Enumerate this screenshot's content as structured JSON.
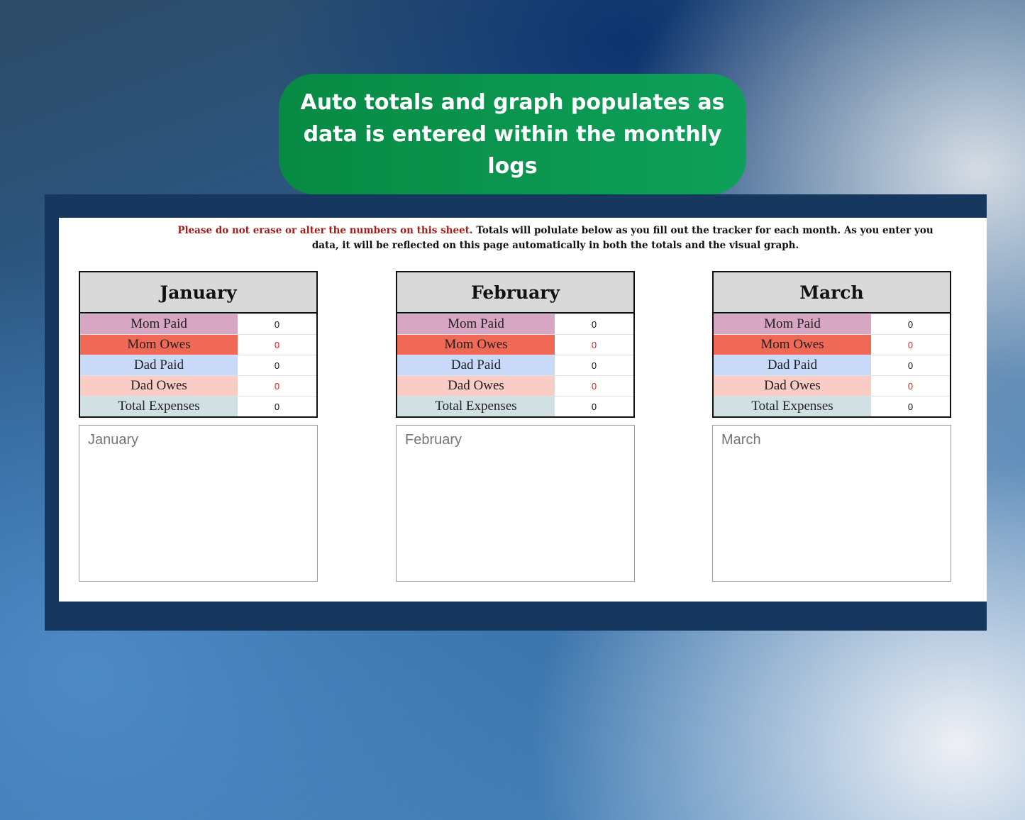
{
  "banner": {
    "line1": "Auto totals and graph populates as",
    "line2": "data is entered within the monthly logs"
  },
  "notice": {
    "warning": "Please do not erase or alter the numbers on this sheet.",
    "text": " Totals will polulate below as you fill out the tracker for each month. As you enter you data, it will be reflected on this page automatically in both the totals and the visual graph."
  },
  "months": [
    {
      "name": "January",
      "rows": [
        {
          "label": "Mom Paid",
          "value": "0"
        },
        {
          "label": "Mom Owes",
          "value": "0"
        },
        {
          "label": "Dad Paid",
          "value": "0"
        },
        {
          "label": "Dad Owes",
          "value": "0"
        },
        {
          "label": "Total Expenses",
          "value": "0"
        }
      ],
      "chart_title": "January"
    },
    {
      "name": "February",
      "rows": [
        {
          "label": "Mom Paid",
          "value": "0"
        },
        {
          "label": "Mom Owes",
          "value": "0"
        },
        {
          "label": "Dad Paid",
          "value": "0"
        },
        {
          "label": "Dad Owes",
          "value": "0"
        },
        {
          "label": "Total Expenses",
          "value": "0"
        }
      ],
      "chart_title": "February"
    },
    {
      "name": "March",
      "rows": [
        {
          "label": "Mom Paid",
          "value": "0"
        },
        {
          "label": "Mom Owes",
          "value": "0"
        },
        {
          "label": "Dad Paid",
          "value": "0"
        },
        {
          "label": "Dad Owes",
          "value": "0"
        },
        {
          "label": "Total Expenses",
          "value": "0"
        }
      ],
      "chart_title": "March"
    }
  ],
  "colors": {
    "banner": "#0b9a50",
    "frame": "#17385e",
    "mom_paid": "#d6a6c2",
    "mom_owes": "#f06856",
    "dad_paid": "#c9daf8",
    "dad_owes": "#f9cdc6",
    "total_expenses": "#d0e0e3",
    "owes_value": "#e02020"
  }
}
